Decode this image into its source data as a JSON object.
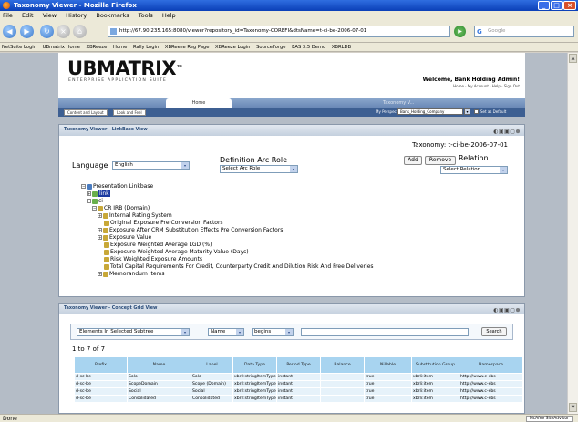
{
  "window": {
    "title": "Taxonomy Viewer - Mozilla Firefox"
  },
  "menu": [
    "File",
    "Edit",
    "View",
    "History",
    "Bookmarks",
    "Tools",
    "Help"
  ],
  "nav": {
    "url": "http://67.90.235.165:8080/viewer?repository_id=Taxonomy-COREFI&dtsName=t-ci-be-2006-07-01",
    "search_placeholder": "Google"
  },
  "bookmarks": [
    "NetSuite Login",
    "UBmatrix Home",
    "XBReeze",
    "Home",
    "Rally Login",
    "XBReeze Reg Page",
    "XBReeze Login",
    "SourceForge",
    "EAS 3.5 Demo",
    "XBRLDB"
  ],
  "app": {
    "logo": "UBMATRIX",
    "logo_tm": "™",
    "logo_sub": "ENTERPRISE APPLICATION SUITE",
    "welcome": "Welcome, Bank Holding Admin!",
    "header_links": "Home · My Account · Help · Sign Out",
    "tab_home": "Home",
    "tab_right": "Taxonomy V...",
    "toolbar_buttons": [
      "Content and Layout",
      "Look and Feel"
    ],
    "perspective_label": "My Perspective",
    "perspective_value": "Bank_Holding_Company",
    "default_label": "Set as Default"
  },
  "linkbase": {
    "title": "Taxonomy Viewer - LinkBase View",
    "controls": "◐▣▣▢⊗",
    "taxonomy": "Taxonomy: t-ci-be-2006-07-01",
    "language_label": "Language",
    "language_value": "English",
    "defarc_label": "Definition Arc Role",
    "defarc_value": "Select Arc Role",
    "add": "Add",
    "remove": "Remove",
    "relation_label": "Relation",
    "relation_value": "Select Relation",
    "tree": {
      "root": "Presentation Linkbase",
      "link": "link",
      "ci": "ci",
      "domain": "CR IRB (Domain)",
      "items": [
        "Internal Rating System",
        "Original Exposure Pre Conversion Factors",
        "Exposure After CRM Substitution Effects Pre Conversion Factors",
        "Exposure Value",
        "Exposure Weighted Average LGD (%)",
        "Exposure Weighted Average Maturity Value (Days)",
        "Risk Weighted Exposure Amounts",
        "Total Capital Requirements For Credit, Counterparty Credit And Dilution Risk And Free Deliveries",
        "Memorandum Items"
      ]
    }
  },
  "grid": {
    "title": "Taxonomy Viewer - Concept Grid View",
    "controls": "◐▣▣▢⊗",
    "filter_scope": "Elements In Selected Subtree",
    "filter_field": "Name",
    "filter_op": "begins",
    "search": "Search",
    "count": "1 to 7 of 7",
    "columns": [
      "Prefix",
      "Name",
      "Label",
      "Data Type",
      "Period Type",
      "Balance",
      "Nillable",
      "Substitution Group",
      "Namespace"
    ],
    "rows": [
      [
        "d-sc-be",
        "Solo",
        "Solo",
        "xbrli:stringItemType",
        "instant",
        "",
        "true",
        "xbrli:item",
        "http://www.c-ebs"
      ],
      [
        "d-sc-be",
        "ScopeDomain",
        "Scope (Domain)",
        "xbrli:stringItemType",
        "instant",
        "",
        "true",
        "xbrli:item",
        "http://www.c-ebs"
      ],
      [
        "d-sc-be",
        "Social",
        "Social",
        "xbrli:stringItemType",
        "instant",
        "",
        "true",
        "xbrli:item",
        "http://www.c-ebs"
      ],
      [
        "d-sc-be",
        "Consolidated",
        "Consolidated",
        "xbrli:stringItemType",
        "instant",
        "",
        "true",
        "xbrli:item",
        "http://www.c-ebs"
      ]
    ]
  },
  "status": {
    "text": "Done",
    "right": "McAfee SiteAdvisor"
  }
}
